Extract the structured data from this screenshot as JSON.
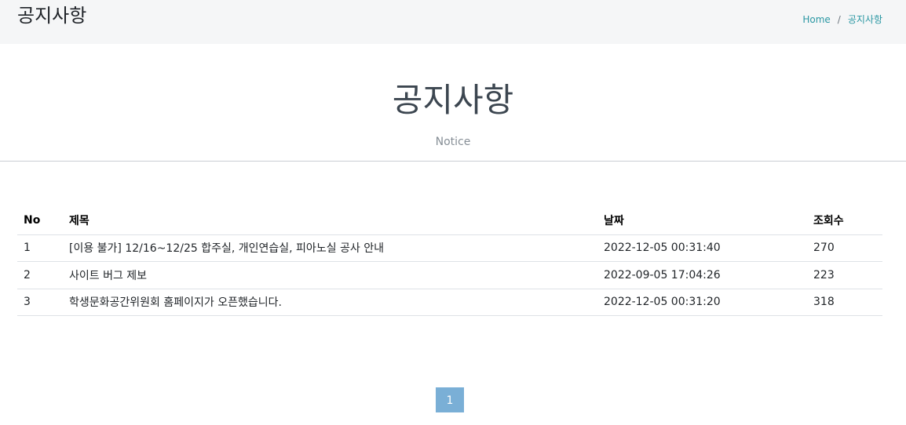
{
  "header": {
    "title": "공지사항",
    "breadcrumb": {
      "home": "Home",
      "separator": "/",
      "current": "공지사항"
    }
  },
  "hero": {
    "title": "공지사항",
    "subtitle": "Notice"
  },
  "table": {
    "columns": {
      "no": "No",
      "title": "제목",
      "date": "날짜",
      "views": "조회수"
    },
    "rows": [
      {
        "no": "1",
        "title": "[이용 불가] 12/16~12/25 합주실, 개인연습실, 피아노실 공사 안내",
        "date": "2022-12-05 00:31:40",
        "views": "270"
      },
      {
        "no": "2",
        "title": "사이트 버그 제보",
        "date": "2022-09-05 17:04:26",
        "views": "223"
      },
      {
        "no": "3",
        "title": "학생문화공간위원회 홈페이지가 오픈했습니다.",
        "date": "2022-12-05 00:31:20",
        "views": "318"
      }
    ]
  },
  "pagination": {
    "pages": [
      "1"
    ],
    "current": "1"
  },
  "colors": {
    "accent": "#2a97a3",
    "page_active": "#7aafd6",
    "topbar_bg": "#f5f6f7"
  }
}
